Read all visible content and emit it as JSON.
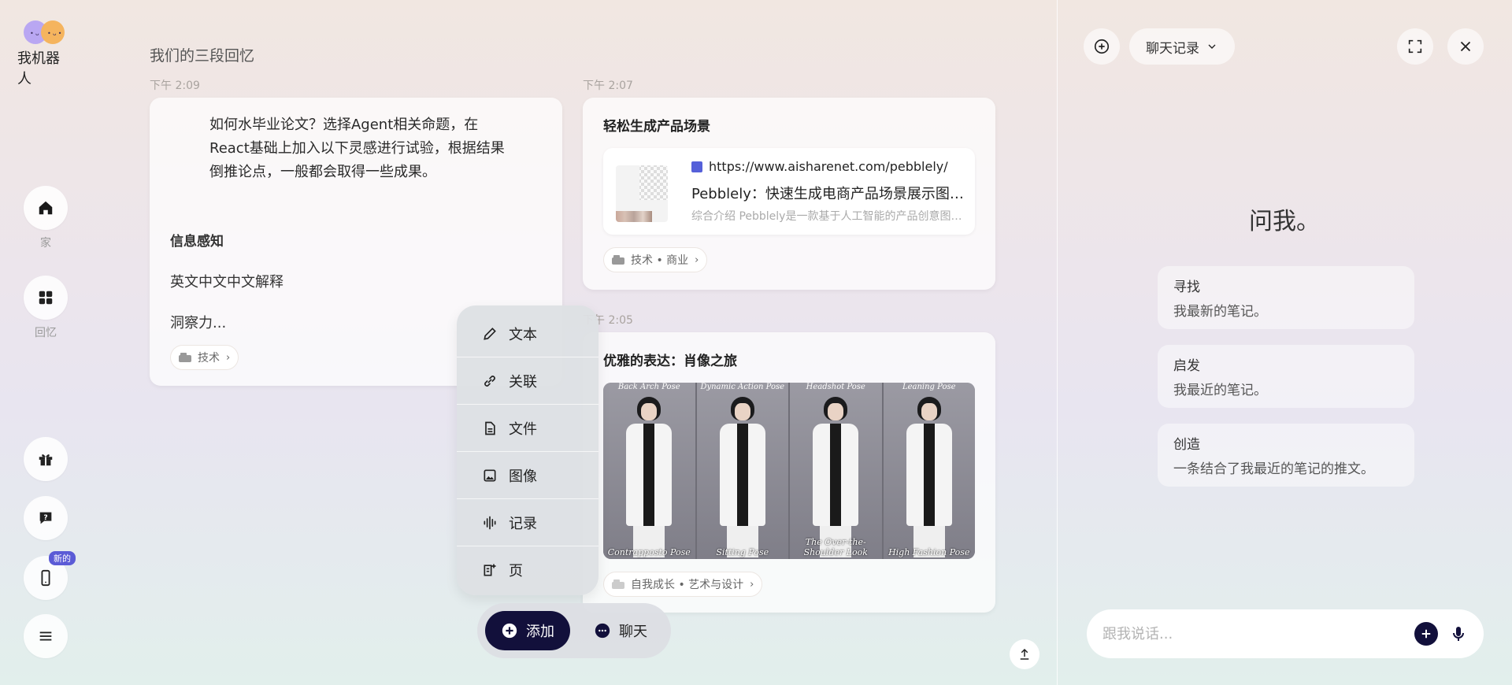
{
  "app": {
    "logo_text": "我机器人",
    "logo_eyes": "•ᴗ•"
  },
  "rail": {
    "home_label": "家",
    "memory_label": "回忆",
    "new_badge": "新的"
  },
  "main": {
    "section_title": "我们的三段回忆",
    "card1": {
      "time": "下午 2:09",
      "body": "如何水毕业论文？选择Agent相关命题，在React基础上加入以下灵感进行试验，根据结果倒推论点，一般都会取得一些成果。",
      "heading": "信息感知",
      "para1": "英文中文中文解释",
      "para2": "洞察力...",
      "tag": "技术"
    },
    "card2": {
      "time": "下午 2:07",
      "title": "轻松生成产品场景",
      "link_url": "https://www.aisharenet.com/pebblely/",
      "link_title": "Pebblely：快速生成电商产品场景展示图片的AI工具",
      "link_desc": "综合介绍 Pebblely是一款基于人工智能的产品创意图片生成工具",
      "tag": "技术 • 商业"
    },
    "card3": {
      "time": "下午 2:05",
      "title": "优雅的表达：肖像之旅",
      "poses_top": [
        "Back Arch Pose",
        "Dynamic Action Pose",
        "Headshot Pose",
        "Leaning Pose"
      ],
      "poses_bottom": [
        "Contrapposto Pose",
        "Sitting Pose",
        "The Over-the-Shoulder Look",
        "High Fashion Pose"
      ],
      "tag": "自我成长 • 艺术与设计"
    }
  },
  "menu": {
    "items": [
      {
        "label": "文本",
        "icon": "pencil-icon"
      },
      {
        "label": "关联",
        "icon": "link-icon"
      },
      {
        "label": "文件",
        "icon": "file-icon"
      },
      {
        "label": "图像",
        "icon": "image-icon"
      },
      {
        "label": "记录",
        "icon": "waveform-icon"
      },
      {
        "label": "页",
        "icon": "page-add-icon"
      }
    ]
  },
  "bottom": {
    "add_label": "添加",
    "chat_label": "聊天"
  },
  "right": {
    "history_label": "聊天记录",
    "ask_title": "问我。",
    "suggestions": [
      {
        "title": "寻找",
        "sub": "我最新的笔记。"
      },
      {
        "title": "启发",
        "sub": "我最近的笔记。"
      },
      {
        "title": "创造",
        "sub": "一条结合了我最近的笔记的推文。"
      }
    ],
    "input_placeholder": "跟我说话..."
  },
  "colors": {
    "accent_dark": "#12103b",
    "badge": "#5b5bd6"
  }
}
